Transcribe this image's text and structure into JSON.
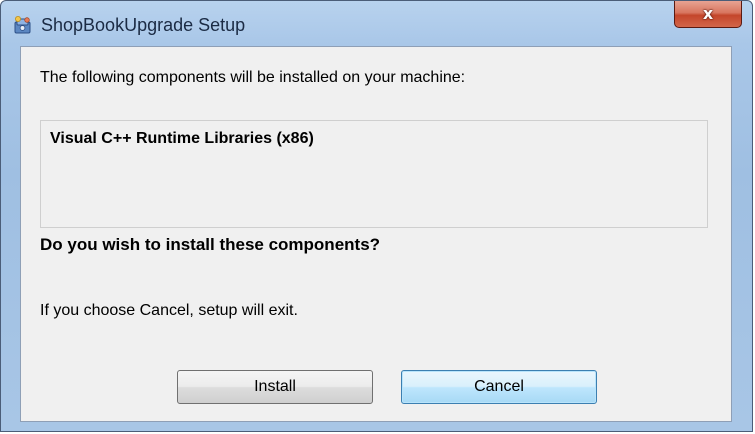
{
  "window": {
    "title": "ShopBookUpgrade Setup",
    "icon": "installer-icon",
    "close_label": "x"
  },
  "content": {
    "intro": "The following components will be installed on your machine:",
    "components": [
      "Visual C++ Runtime Libraries (x86)"
    ],
    "question": "Do you wish to install these components?",
    "cancel_note": "If you choose Cancel, setup will exit."
  },
  "buttons": {
    "install_label": "Install",
    "cancel_label": "Cancel",
    "default_button": "cancel"
  },
  "colors": {
    "titlebar": "#a9c7e8",
    "close_button": "#c4462b",
    "client_bg": "#f0f0f0",
    "focused_button_border": "#3c7fb1"
  }
}
